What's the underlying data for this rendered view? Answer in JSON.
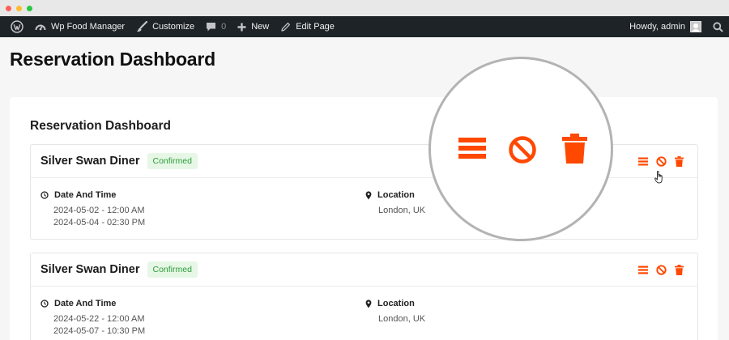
{
  "window": {
    "traffic_lights": [
      "#ff5f57",
      "#febc2e",
      "#28c840"
    ]
  },
  "admin_bar": {
    "site_name": "Wp Food Manager",
    "customize": "Customize",
    "comments_count": "0",
    "new": "New",
    "edit_page": "Edit Page",
    "greeting": "Howdy, admin"
  },
  "page": {
    "title": "Reservation Dashboard"
  },
  "dashboard": {
    "title": "Reservation Dashboard",
    "accent_color": "#ff4800",
    "reservations": [
      {
        "name": "Silver Swan Diner",
        "status": "Confirmed",
        "date_label": "Date And Time",
        "start": "2024-05-02 - 12:00 AM",
        "end": "2024-05-04 - 02:30 PM",
        "location_label": "Location",
        "location": "London, UK"
      },
      {
        "name": "Silver Swan Diner",
        "status": "Confirmed",
        "date_label": "Date And Time",
        "start": "2024-05-22 - 12:00 AM",
        "end": "2024-05-07 - 10:30 PM",
        "location_label": "Location",
        "location": "London, UK"
      }
    ],
    "action_icons": [
      "menu-icon",
      "ban-icon",
      "trash-icon"
    ]
  }
}
